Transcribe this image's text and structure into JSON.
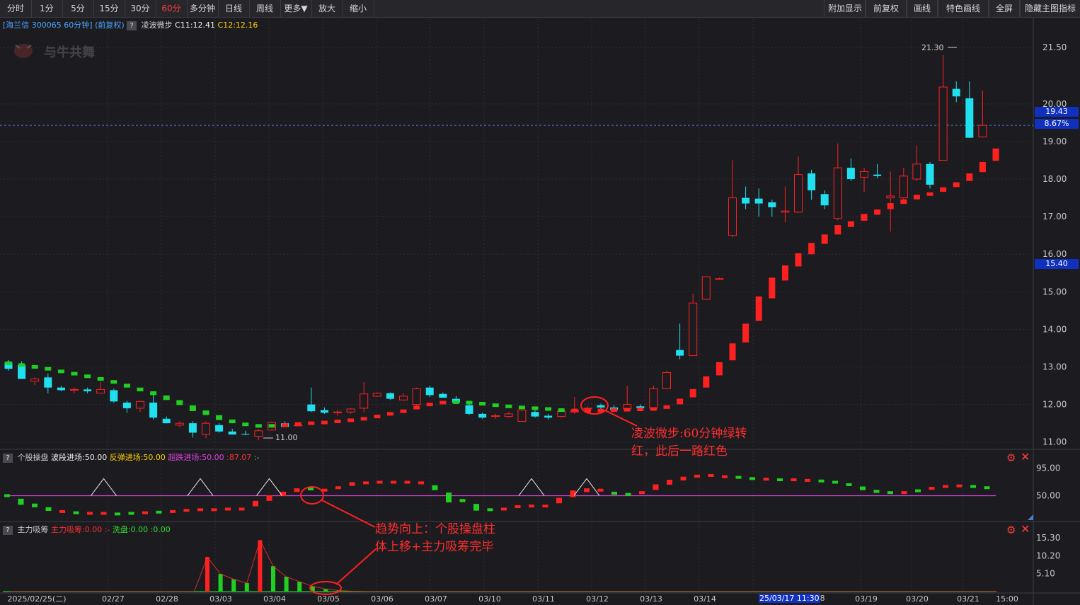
{
  "toolbar": {
    "left": [
      "分时",
      "1分",
      "5分",
      "15分",
      "30分",
      "60分",
      "多分钟",
      "日线",
      "周线",
      "更多▼",
      "放大",
      "缩小"
    ],
    "active": "60分",
    "right": [
      "附加显示",
      "前复权",
      "画线",
      "特色画线",
      "全屏",
      "隐藏主图指标"
    ]
  },
  "main_header": {
    "stock": "[海兰信 300065 60分钟]",
    "adjust": "(前复权)",
    "q": "?",
    "indicator": "凌波微步",
    "c1": "C11:12.41",
    "c2": "C12:12.16"
  },
  "watermark": "与牛共舞",
  "price_tags": {
    "current": "19.43",
    "pct": "8.67%",
    "marker": "15.40"
  },
  "labels": {
    "high": "21.30",
    "low": "11.00"
  },
  "sub1_header": {
    "q": "?",
    "name": "个股操盘",
    "f1": "波段进场:50.00",
    "f2": "反弹进场:50.00",
    "f3": "超跌进场:50.00",
    "f4": ":87.07",
    "f5": ":-"
  },
  "sub2_header": {
    "q": "?",
    "name": "主力吸筹",
    "f1": "主力吸筹:0.00",
    "f2": ":-",
    "f3": "洗盘:0.00",
    "f4": ":0.00"
  },
  "annotations": {
    "a1_line1": "凌波微步:60分钟绿转",
    "a1_line2": "红，此后一路红色",
    "a2_line1": "趋势向上：个股操盘柱",
    "a2_line2": "体上移+主力吸筹完毕"
  },
  "x_axis": {
    "labels": [
      "2025/02/25(二)",
      "02/27",
      "02/28",
      "03/03",
      "03/04",
      "03/05",
      "03/06",
      "03/07",
      "03/10",
      "03/11",
      "03/12",
      "03/13",
      "03/14",
      "03/17",
      "03/19",
      "03/20",
      "03/21",
      "15:00"
    ],
    "cursor_label": "25/03/17 11:30",
    "cursor_suffix": "8"
  },
  "colors": {
    "up": "#ff2020",
    "down": "#20e0f0",
    "green": "#20d020",
    "bg": "#1c1c20",
    "axis": "#c8c8c8",
    "magenta": "#d040d0"
  },
  "chart_data": [
    {
      "type": "candlestick",
      "title": "海兰信 300065 60分钟",
      "y_ticks": [
        11.0,
        12.0,
        13.0,
        14.0,
        15.0,
        16.0,
        17.0,
        18.0,
        19.0,
        20.0,
        21.5
      ],
      "ylim": [
        10.9,
        21.9
      ],
      "current_price": 19.43,
      "ohlc": [
        [
          13.12,
          13.18,
          12.9,
          12.95
        ],
        [
          13.05,
          13.15,
          12.68,
          12.68
        ],
        [
          12.62,
          12.72,
          12.52,
          12.68
        ],
        [
          12.72,
          12.82,
          12.3,
          12.45
        ],
        [
          12.45,
          12.5,
          12.35,
          12.38
        ],
        [
          12.38,
          12.45,
          12.3,
          12.4
        ],
        [
          12.4,
          12.45,
          12.3,
          12.35
        ],
        [
          12.3,
          12.6,
          12.3,
          12.4
        ],
        [
          12.38,
          12.42,
          12.05,
          12.08
        ],
        [
          12.05,
          12.1,
          11.78,
          11.9
        ],
        [
          11.9,
          12.1,
          11.8,
          12.08
        ],
        [
          12.05,
          12.35,
          11.6,
          11.65
        ],
        [
          11.62,
          11.68,
          11.5,
          11.5
        ],
        [
          11.45,
          11.55,
          11.4,
          11.5
        ],
        [
          11.5,
          11.55,
          11.12,
          11.25
        ],
        [
          11.2,
          11.55,
          11.1,
          11.5
        ],
        [
          11.45,
          11.5,
          11.25,
          11.28
        ],
        [
          11.28,
          11.35,
          11.2,
          11.2
        ],
        [
          11.22,
          11.3,
          11.18,
          11.2
        ],
        [
          11.15,
          11.35,
          11.05,
          11.3
        ],
        [
          11.32,
          11.55,
          11.3,
          11.52
        ],
        [
          11.5,
          11.55,
          11.42,
          11.4
        ],
        [
          11.45,
          11.5,
          11.42,
          11.45
        ],
        [
          12.0,
          12.45,
          11.8,
          11.82
        ],
        [
          11.85,
          11.92,
          11.75,
          11.78
        ],
        [
          11.8,
          11.85,
          11.7,
          11.8
        ],
        [
          11.8,
          11.9,
          11.75,
          11.88
        ],
        [
          11.9,
          12.6,
          11.8,
          12.28
        ],
        [
          12.22,
          12.32,
          12.2,
          12.3
        ],
        [
          12.3,
          12.32,
          12.12,
          12.15
        ],
        [
          12.12,
          12.3,
          12.1,
          12.22
        ],
        [
          12.0,
          12.45,
          11.95,
          12.42
        ],
        [
          12.45,
          12.5,
          12.2,
          12.25
        ],
        [
          12.28,
          12.32,
          12.18,
          12.18
        ],
        [
          12.15,
          12.22,
          12.02,
          12.05
        ],
        [
          11.98,
          12.05,
          11.72,
          11.75
        ],
        [
          11.75,
          11.78,
          11.62,
          11.65
        ],
        [
          11.68,
          11.75,
          11.62,
          11.7
        ],
        [
          11.68,
          11.8,
          11.65,
          11.75
        ],
        [
          11.55,
          11.88,
          11.55,
          11.85
        ],
        [
          11.8,
          11.85,
          11.65,
          11.68
        ],
        [
          11.7,
          11.75,
          11.6,
          11.65
        ],
        [
          11.68,
          11.85,
          11.65,
          11.82
        ],
        [
          11.8,
          12.2,
          11.75,
          11.85
        ],
        [
          11.9,
          11.95,
          11.82,
          11.9
        ],
        [
          11.98,
          12.02,
          11.85,
          11.92
        ],
        [
          11.92,
          11.98,
          11.85,
          11.85
        ],
        [
          11.88,
          12.5,
          11.85,
          12.0
        ],
        [
          11.95,
          12.0,
          11.85,
          11.9
        ],
        [
          11.9,
          12.5,
          11.85,
          12.42
        ],
        [
          12.42,
          12.9,
          12.42,
          12.85
        ],
        [
          13.45,
          14.15,
          13.2,
          13.3
        ],
        [
          13.3,
          14.95,
          13.3,
          14.7
        ],
        [
          14.8,
          15.4,
          14.8,
          15.4
        ],
        [
          15.35,
          15.38,
          15.32,
          15.35
        ],
        [
          16.5,
          18.5,
          16.45,
          17.5
        ],
        [
          17.5,
          17.8,
          17.2,
          17.35
        ],
        [
          17.48,
          17.75,
          17.0,
          17.35
        ],
        [
          17.38,
          17.45,
          17.0,
          17.25
        ],
        [
          17.12,
          17.8,
          16.85,
          17.15
        ],
        [
          17.12,
          18.6,
          17.1,
          18.12
        ],
        [
          18.15,
          18.25,
          17.45,
          17.7
        ],
        [
          17.6,
          17.7,
          17.2,
          17.3
        ],
        [
          16.95,
          18.95,
          16.9,
          18.3
        ],
        [
          18.3,
          18.55,
          17.95,
          18.0
        ],
        [
          18.05,
          18.3,
          17.65,
          18.2
        ],
        [
          18.12,
          18.4,
          18.02,
          18.08
        ],
        [
          17.5,
          18.2,
          16.6,
          17.55
        ],
        [
          17.5,
          18.3,
          17.45,
          18.08
        ],
        [
          18.0,
          18.9,
          17.95,
          18.4
        ],
        [
          18.4,
          18.45,
          17.75,
          17.85
        ],
        [
          18.5,
          21.3,
          18.5,
          20.45
        ],
        [
          20.4,
          20.6,
          20.05,
          20.2
        ],
        [
          20.15,
          20.6,
          19.1,
          19.1
        ],
        [
          19.12,
          20.35,
          19.1,
          19.43
        ]
      ],
      "indicator": {
        "name": "凌波微步",
        "values": [
          13.1,
          13.05,
          13.0,
          12.95,
          12.88,
          12.82,
          12.75,
          12.68,
          12.6,
          12.5,
          12.4,
          12.3,
          12.18,
          12.05,
          11.9,
          11.78,
          11.65,
          11.55,
          11.47,
          11.43,
          11.43,
          11.45,
          11.48,
          11.5,
          11.52,
          11.55,
          11.58,
          11.62,
          11.68,
          11.75,
          11.82,
          11.92,
          12.0,
          12.05,
          12.06,
          12.05,
          12.02,
          11.98,
          11.95,
          11.92,
          11.9,
          11.88,
          11.85,
          11.84,
          11.83,
          11.84,
          11.85,
          11.86,
          11.87,
          11.88,
          11.93,
          12.08,
          12.3,
          12.6,
          12.95,
          13.4,
          13.9,
          14.55,
          15.1,
          15.5,
          15.85,
          16.15,
          16.4,
          16.65,
          16.8,
          16.98,
          17.12,
          17.28,
          17.4,
          17.52,
          17.6,
          17.72,
          17.85,
          18.05,
          18.32,
          18.65
        ],
        "colors": [
          "g",
          "g",
          "g",
          "g",
          "g",
          "g",
          "g",
          "g",
          "g",
          "g",
          "g",
          "g",
          "g",
          "g",
          "g",
          "g",
          "g",
          "g",
          "g",
          "g",
          "g",
          "r",
          "r",
          "r",
          "r",
          "r",
          "r",
          "r",
          "r",
          "r",
          "r",
          "r",
          "r",
          "r",
          "g",
          "g",
          "g",
          "g",
          "g",
          "g",
          "g",
          "g",
          "g",
          "r",
          "r",
          "r",
          "r",
          "r",
          "r",
          "r",
          "r",
          "r",
          "r",
          "r",
          "r",
          "r",
          "r",
          "r",
          "r",
          "r",
          "r",
          "r",
          "r",
          "r",
          "r",
          "r",
          "r",
          "r",
          "r",
          "r",
          "r",
          "r",
          "r",
          "r",
          "r",
          "r"
        ]
      }
    },
    {
      "type": "bar",
      "title": "个股操盘",
      "y_ticks": [
        50.0,
        95.0
      ],
      "ylim": [
        10,
        105
      ],
      "level_line": 50.0,
      "values": [
        50,
        40,
        34,
        28,
        24,
        22,
        21,
        21,
        20,
        21,
        22,
        23,
        24,
        26,
        27,
        27,
        28,
        28,
        37,
        46,
        53,
        59,
        61,
        59,
        63,
        69,
        71,
        72,
        72,
        72,
        71,
        63,
        47,
        42,
        31,
        27,
        28,
        32,
        33,
        33,
        42,
        53,
        59,
        59,
        54,
        52,
        55,
        64,
        72,
        78,
        82,
        83,
        81,
        80,
        78,
        77,
        76,
        76,
        75,
        74,
        72,
        68,
        62,
        57,
        55,
        55,
        58,
        62,
        65,
        66,
        65,
        63
      ],
      "colors": [
        "g",
        "g",
        "g",
        "g",
        "r",
        "g",
        "r",
        "r",
        "g",
        "g",
        "r",
        "g",
        "r",
        "r",
        "r",
        "r",
        "r",
        "r",
        "r",
        "r",
        "r",
        "r",
        "g",
        "r",
        "r",
        "r",
        "r",
        "r",
        "r",
        "r",
        "r",
        "g",
        "g",
        "g",
        "g",
        "g",
        "r",
        "r",
        "r",
        "r",
        "r",
        "r",
        "r",
        "r",
        "g",
        "g",
        "r",
        "r",
        "r",
        "r",
        "r",
        "r",
        "r",
        "g",
        "g",
        "r",
        "g",
        "r",
        "r",
        "g",
        "g",
        "g",
        "g",
        "g",
        "g",
        "r",
        "g",
        "r",
        "r",
        "r",
        "g",
        "g"
      ],
      "triangles_at": [
        7,
        14,
        19,
        38,
        42
      ]
    },
    {
      "type": "bar",
      "title": "主力吸筹",
      "y_ticks": [
        5.1,
        10.2,
        15.3
      ],
      "ylim": [
        0,
        16.5
      ],
      "series": [
        {
          "name": "主力吸筹",
          "values": [
            0,
            0,
            0,
            0,
            0,
            0,
            0,
            0,
            0,
            0,
            0,
            0,
            0,
            0,
            0,
            9.8,
            0,
            0,
            0,
            14.6,
            0,
            0,
            0,
            0,
            0,
            0,
            0,
            0,
            0,
            0,
            0,
            0,
            0,
            0,
            0,
            0,
            0,
            0,
            0,
            0,
            0,
            0,
            0,
            0,
            0,
            0,
            0,
            0,
            0,
            0,
            0,
            0,
            0,
            0,
            0,
            0,
            0,
            0,
            0,
            0,
            0,
            0,
            0,
            0,
            0,
            0,
            0,
            0,
            0,
            0,
            0,
            0,
            0,
            0,
            0,
            0
          ]
        },
        {
          "name": "洗盘",
          "values": [
            0,
            0,
            0,
            0,
            0,
            0,
            0,
            0,
            0,
            0,
            0,
            0,
            0,
            0,
            0,
            0,
            5.0,
            3.5,
            2.4,
            0,
            7.2,
            4.2,
            2.8,
            1.5,
            0.7,
            0.3,
            0.1,
            0,
            0,
            0,
            0,
            0,
            0,
            0,
            0,
            0,
            0,
            0,
            0,
            0,
            0,
            0,
            0,
            0,
            0,
            0,
            0,
            0,
            0,
            0,
            0,
            0,
            0,
            0,
            0,
            0,
            0,
            0,
            0,
            0,
            0,
            0,
            0,
            0,
            0,
            0,
            0,
            0,
            0,
            0,
            0,
            0,
            0,
            0,
            0,
            0
          ]
        }
      ]
    }
  ]
}
